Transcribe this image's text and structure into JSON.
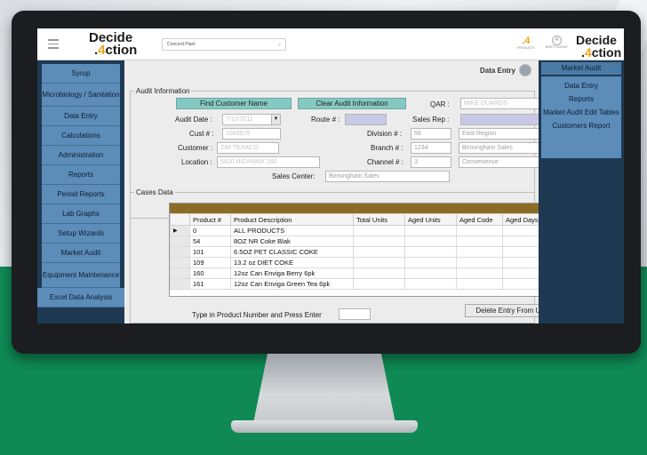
{
  "app": {
    "logo_line1": "Decide",
    "logo_prefix": ".",
    "logo_digit": "4",
    "logo_rest": "ction",
    "plant_select": "Concord Plant",
    "products_count": ".4",
    "products_label": "PRODUCTS",
    "user_initial": "A",
    "user_label": "BRETT BOOKE"
  },
  "left_nav": {
    "items": [
      {
        "label": "Syrup"
      },
      {
        "label": "Microbiology / Sanitation"
      },
      {
        "label": "Data Entry"
      },
      {
        "label": "Calculations"
      },
      {
        "label": "Administration"
      },
      {
        "label": "Reports"
      },
      {
        "label": "Period Reports"
      },
      {
        "label": "Lab Graphs"
      },
      {
        "label": "Setup Wizards"
      },
      {
        "label": "Market Audit"
      },
      {
        "label": "Equipment Maintenance"
      },
      {
        "label": "Excel Data Analysis"
      }
    ]
  },
  "page": {
    "title": "Data Entry"
  },
  "audit_info": {
    "legend": "Audit Information",
    "find_customer_btn": "Find Customer Name",
    "clear_btn": "Clear Audit Information",
    "labels": {
      "qar": "QAR :",
      "audit_date": "Audit Date :",
      "route": "Route # :",
      "sales_rep": "Sales Rep :",
      "cust": "Cust # :",
      "division": "Division # :",
      "customer": "Customer :",
      "branch": "Branch # :",
      "location": "Location :",
      "channel": "Channel # :",
      "sales_center": "Sales Center:"
    },
    "values": {
      "qar": "MIKE DUARDS",
      "audit_date": "7/12/2011",
      "route": "",
      "sales_rep": "",
      "cust": "1003578",
      "division": "56",
      "division_name": "East Region",
      "customer": "ZIM TEXACO",
      "branch": "1234",
      "branch_name": "Birmingham Sales",
      "location": "5420 HIGHWAY 280",
      "channel": "3",
      "channel_name": "Convenience",
      "sales_center": "Birmingham Sales"
    }
  },
  "cases_data": {
    "legend": "Cases Data",
    "columns": [
      "Product #",
      "Product Description",
      "Total Units",
      "Aged Units",
      "Aged Code",
      "Aged Days"
    ],
    "current_row_marker": "▶",
    "rows": [
      {
        "product": "0",
        "description": "ALL PRODUCTS"
      },
      {
        "product": "54",
        "description": "8OZ NR Coke Blak"
      },
      {
        "product": "101",
        "description": "6.5OZ PET CLASSIC COKE"
      },
      {
        "product": "109",
        "description": "13.2 oz DIET COKE"
      },
      {
        "product": "160",
        "description": "12oz Can Enviga Berry 6pk"
      },
      {
        "product": "161",
        "description": "12oz Can Enviga Green Tea 6pk"
      }
    ],
    "type_in_label": "Type in Product Number and Press Enter",
    "delete_btn": "Delete Entry From Units"
  },
  "right_panel": {
    "header": "Market Audit",
    "links": [
      "Data Entry",
      "Reports",
      "Market Audit Edit Tables",
      "Customers Report"
    ]
  },
  "colors": {
    "nav_bg": "#1e3a52",
    "nav_item": "#5c8cb8",
    "teal_button": "#86c9c2",
    "grid_header_bar": "#8c6b26",
    "green_backdrop": "#0f8a55",
    "logo_accent": "#f2a21b"
  }
}
